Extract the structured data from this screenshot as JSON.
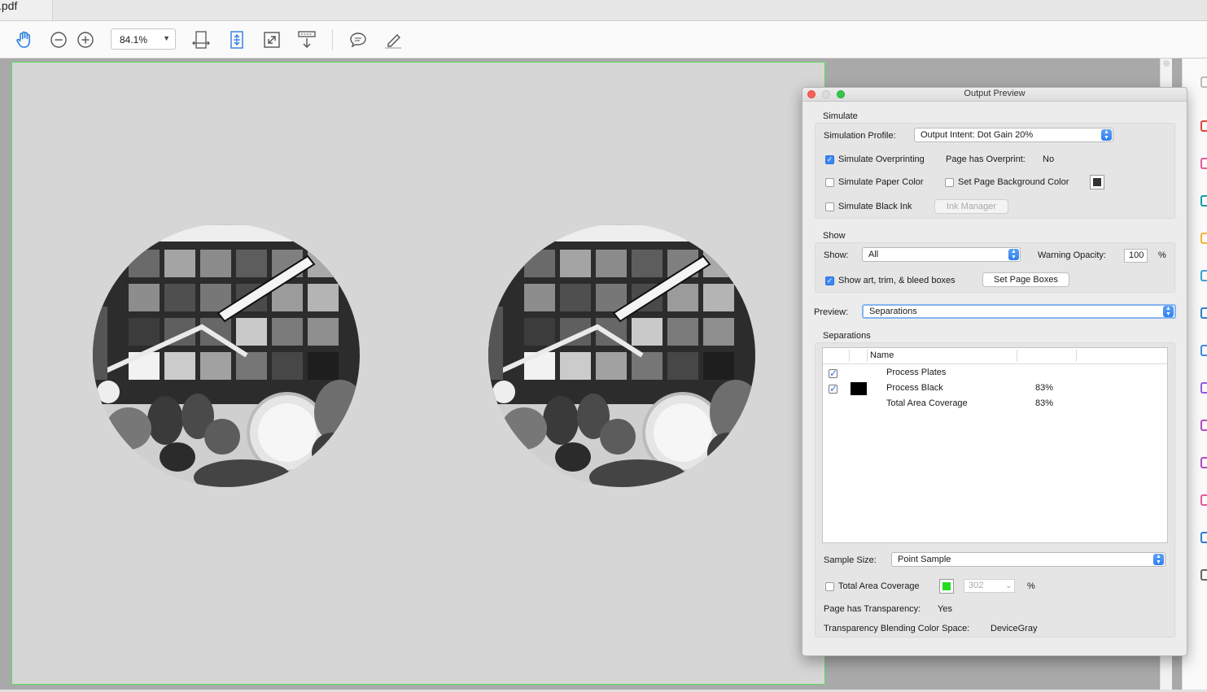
{
  "tab": {
    "title": ".pdf"
  },
  "toolbar": {
    "zoom_value": "84.1%",
    "tools": [
      "hand-tool",
      "zoom-out",
      "zoom-in",
      "fit-width",
      "fit-page",
      "full-screen",
      "scrolling-mode",
      "comment",
      "highlight"
    ]
  },
  "document": {
    "images": [
      "color-checker-fruit-image-left",
      "color-checker-fruit-image-right"
    ]
  },
  "panel": {
    "title": "Output Preview",
    "simulate": {
      "heading": "Simulate",
      "profile_label": "Simulation Profile:",
      "profile_value": "Output Intent: Dot Gain 20%",
      "overprinting_label": "Simulate Overprinting",
      "overprinting_checked": true,
      "page_overprint_label": "Page has Overprint:",
      "page_overprint_value": "No",
      "paper_color_label": "Simulate Paper Color",
      "paper_color_checked": false,
      "page_bg_label": "Set Page Background Color",
      "page_bg_checked": false,
      "page_bg_color": "#333333",
      "black_ink_label": "Simulate Black Ink",
      "black_ink_checked": false,
      "ink_manager_label": "Ink Manager"
    },
    "show": {
      "heading": "Show",
      "show_label": "Show:",
      "show_value": "All",
      "warning_opacity_label": "Warning Opacity:",
      "warning_opacity_value": "100",
      "percent": "%",
      "boxes_label": "Show art, trim, & bleed boxes",
      "boxes_checked": true,
      "set_page_boxes_label": "Set Page Boxes"
    },
    "preview": {
      "label": "Preview:",
      "value": "Separations"
    },
    "separations": {
      "heading": "Separations",
      "column_name": "Name",
      "rows": [
        {
          "name": "Process Plates",
          "checked": true,
          "swatch": "",
          "value": ""
        },
        {
          "name": "Process Black",
          "checked": true,
          "swatch": "#000000",
          "value": "83%"
        },
        {
          "name": "Total Area Coverage",
          "checked": null,
          "swatch": "",
          "value": "83%"
        }
      ]
    },
    "sample": {
      "label": "Sample Size:",
      "value": "Point Sample"
    },
    "coverage": {
      "label": "Total Area Coverage",
      "checked": false,
      "color": "#22dd22",
      "value": "302",
      "percent": "%"
    },
    "transparency": {
      "label": "Page has Transparency:",
      "value": "Yes",
      "blend_label": "Transparency Blending Color Space:",
      "blend_value": "DeviceGray"
    }
  }
}
